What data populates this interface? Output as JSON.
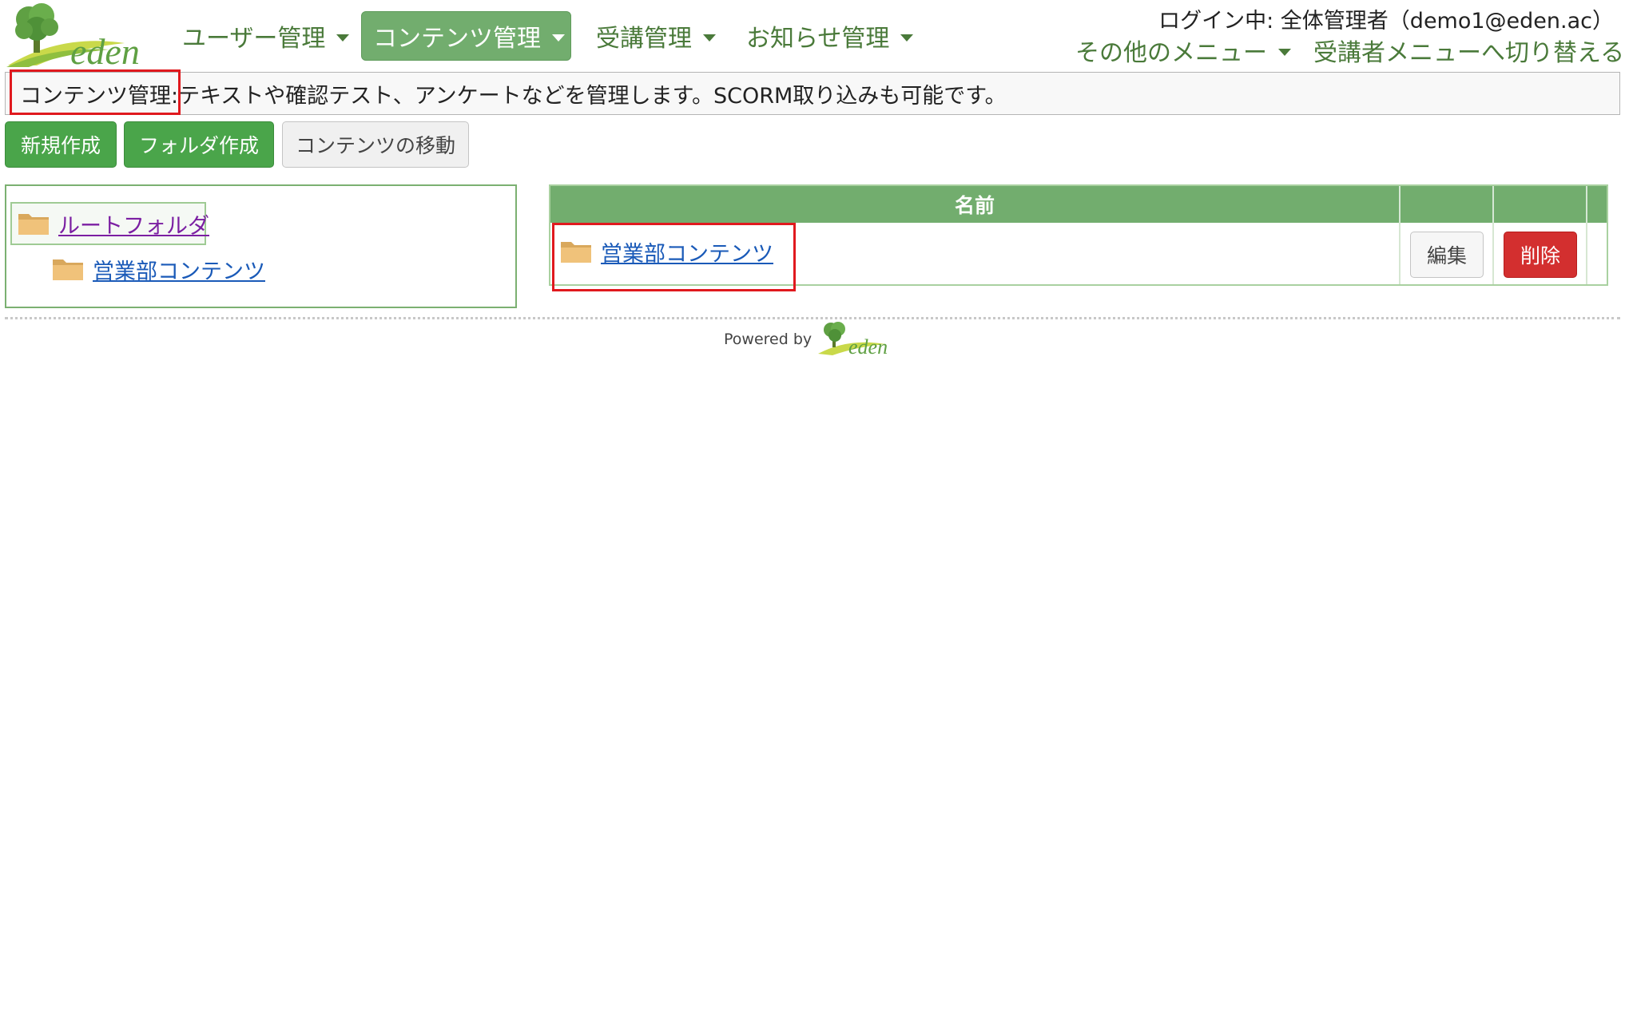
{
  "header": {
    "logo_text": "eden",
    "nav": [
      {
        "label": "ユーザー管理"
      },
      {
        "label": "コンテンツ管理",
        "active": true
      },
      {
        "label": "受講管理"
      },
      {
        "label": "お知らせ管理"
      }
    ],
    "login_info": "ログイン中: 全体管理者（demo1@eden.ac）",
    "other_menu": "その他のメニュー",
    "switch_menu": "受講者メニューへ切り替える"
  },
  "description": {
    "title": "コンテンツ管理:",
    "text": "テキストや確認テスト、アンケートなどを管理します。SCORM取り込みも可能です。"
  },
  "toolbar": {
    "new_label": "新規作成",
    "folder_label": "フォルダ作成",
    "move_label": "コンテンツの移動"
  },
  "tree": {
    "root": "ルートフォルダ",
    "child": "営業部コンテンツ"
  },
  "table": {
    "header_name": "名前",
    "rows": [
      {
        "name": "営業部コンテンツ",
        "edit": "編集",
        "delete": "削除"
      }
    ]
  },
  "footer": {
    "powered_by": "Powered by",
    "logo_text": "eden"
  },
  "colors": {
    "brand_green": "#72ad6e",
    "button_green": "#4aa54a",
    "danger_red": "#d32f2f",
    "highlight_red": "#e0191e"
  },
  "icons": [
    "folder-icon",
    "chevron-down-icon",
    "tree-logo-icon"
  ]
}
